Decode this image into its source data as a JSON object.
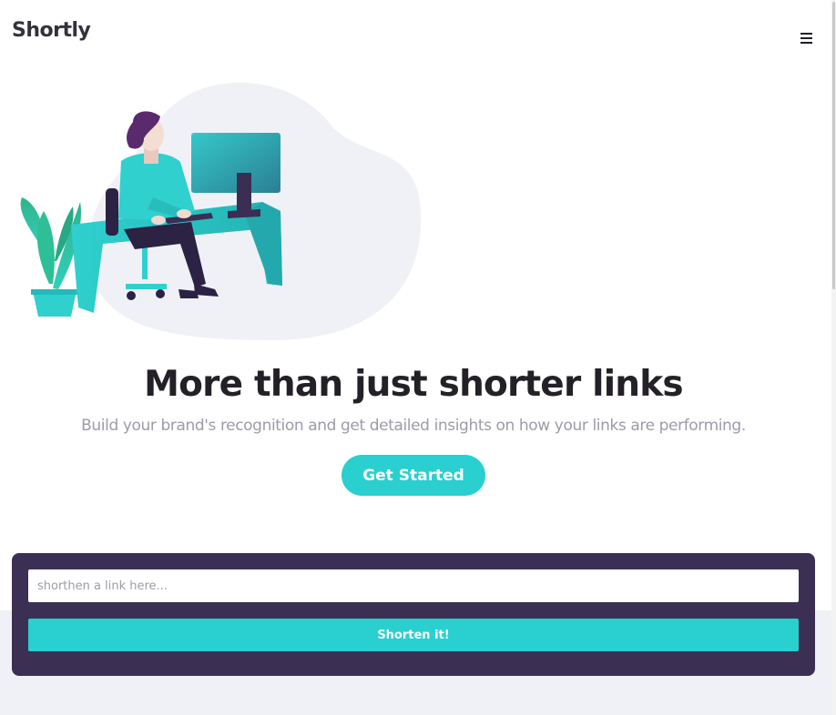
{
  "header": {
    "logo": "Shortly",
    "menu_icon": "hamburger-menu-icon"
  },
  "hero": {
    "illustration": "person-working-at-desk-illustration",
    "title": "More than just shorter links",
    "subtitle": "Build your brand's recognition and get detailed insights on how your links are performing.",
    "cta_label": "Get Started"
  },
  "shorten": {
    "input_value": "",
    "input_placeholder": "shorthen a link here...",
    "button_label": "Shorten it!"
  },
  "colors": {
    "primary": "#2acfcf",
    "dark_violet": "#3b3054",
    "very_dark_violet": "#232127",
    "grayish_violet": "#9e9aa8",
    "light_gray": "#f0f1f6"
  }
}
